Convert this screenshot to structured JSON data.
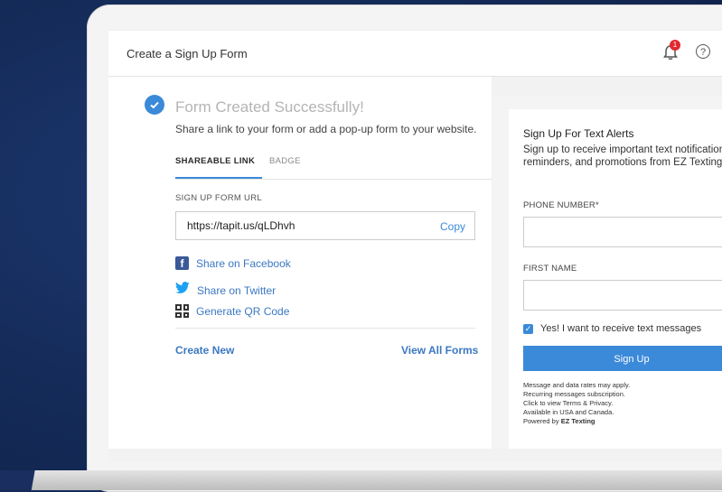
{
  "header": {
    "title": "Create a Sign Up Form",
    "notification_count": "1",
    "help_glyph": "?"
  },
  "success": {
    "title": "Form Created Successfully!",
    "subtitle": "Share a link to your form or add a pop-up form to your website."
  },
  "tabs": [
    {
      "label": "SHAREABLE LINK"
    },
    {
      "label": "BADGE"
    }
  ],
  "url_section": {
    "label": "SIGN UP FORM URL",
    "url": "https://tapit.us/qLDhvh",
    "copy_label": "Copy"
  },
  "share": [
    {
      "label": "Share on Facebook",
      "icon": "facebook-icon"
    },
    {
      "label": "Share on Twitter",
      "icon": "twitter-icon"
    },
    {
      "label": "Generate QR Code",
      "icon": "qr-code-icon"
    }
  ],
  "actions": {
    "create_new": "Create New",
    "view_all": "View All Forms"
  },
  "preview": {
    "title": "Sign Up For Text Alerts",
    "description": "Sign up to receive important text notifications, reminders, and promotions from EZ Texting.",
    "phone_label": "PHONE NUMBER*",
    "first_name_label": "FIRST NAME",
    "optin_text": "Yes! I want to receive text messages",
    "signup_label": "Sign Up",
    "legal_lines": [
      "Message and data rates may apply.",
      "Recurring messages subscription.",
      "Click to view Terms & Privacy.",
      "Available in USA and Canada."
    ],
    "powered_by_prefix": "Powered by ",
    "powered_by_brand": "EZ Texting"
  },
  "colors": {
    "accent": "#3b8ad9",
    "link": "#3b78c2",
    "background": "#142a57"
  }
}
